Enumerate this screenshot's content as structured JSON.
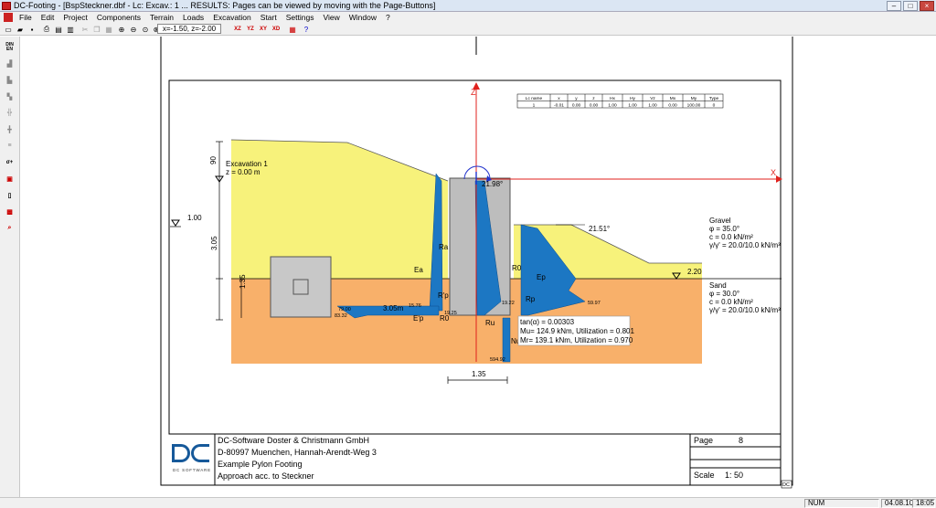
{
  "window": {
    "title": "DC-Footing - [BspSteckner.dbf - Lc: Excav.: 1 ... RESULTS: Pages can be viewed by moving with the Page-Buttons]"
  },
  "menu": [
    "File",
    "Edit",
    "Project",
    "Components",
    "Terrain",
    "Loads",
    "Excavation",
    "Start",
    "Settings",
    "View",
    "Window",
    "?"
  ],
  "toolbar": {
    "coord_display": "x=-1.50, z=-2.00",
    "view_buttons": [
      "XZ",
      "YZ",
      "XY",
      "XD"
    ]
  },
  "lc_table": {
    "headers": [
      "Lc name",
      "x",
      "y",
      "z",
      "Hx",
      "Hy",
      "Vz",
      "Mx",
      "My",
      "Type"
    ],
    "row": [
      "1",
      "-0.01",
      "0.00",
      "0.00",
      "1.00",
      "1.00",
      "1.00",
      "0.00",
      "100.00",
      "0"
    ]
  },
  "drawing": {
    "axis_z": "Z",
    "axis_x": "X",
    "excavation_title": "Excavation 1",
    "excavation_z": "z =  0.00 m",
    "dim_top": "90",
    "dim_water": "1.00",
    "dim_305": "3.05",
    "dim_135_left": "1.35",
    "dim_135_bottom": "1.35",
    "angle_top": "21.98°",
    "angle_right": "21.51°",
    "right_level": "2.20",
    "dim_305m": "3.05m",
    "val_7900": "79.00",
    "val_8332": "83.32",
    "val_1576": "15.76",
    "val_1925": "19.25",
    "val_1922": "19.22",
    "val_5997": "59.97",
    "val_59492": "594.92",
    "label_ra": "Ra",
    "label_ea": "Ea",
    "label_rp1": "R'p",
    "label_ep1": "E'p",
    "label_r0_a": "R0",
    "label_ep2": "Ep",
    "label_rp2": "Rp",
    "label_r0_b": "R0",
    "label_ru": "Ru",
    "label_nu": "Nu",
    "results": [
      "tan(α) = 0.00303",
      "Mu=  124.9 kNm, Utilization = 0.801",
      "Mr=  139.1 kNm, Utilization = 0.970"
    ],
    "gravel": [
      "Gravel",
      "φ      = 35.0°",
      "c      =  0.0 kN/m²",
      "γ/γ' = 20.0/10.0 kN/m³"
    ],
    "sand": [
      "Sand",
      "φ      = 30.0°",
      "c      =  0.0 kN/m²",
      "γ/γ' = 20.0/10.0 kN/m³"
    ]
  },
  "title_block": {
    "company": "DC-Software Doster & Christmann GmbH",
    "address": "D-80997 Muenchen, Hannah-Arendt-Weg 3",
    "project": "Example Pylon Footing",
    "method": "Approach acc. to Steckner",
    "logo_caption": "DC SOFTWARE",
    "page_label": "Page",
    "page_number": "8",
    "scale_label": "Scale",
    "scale_value": "1:  50",
    "corner_tag": "DC"
  },
  "status": {
    "num": "NUM",
    "date": "04.08.10",
    "time": "18:05"
  },
  "colors": {
    "gravel": "#f7f27b",
    "sand": "#f8b06a",
    "pressure": "#1c77c3",
    "concrete": "#bdbdbd",
    "axis": "#e0201c"
  }
}
